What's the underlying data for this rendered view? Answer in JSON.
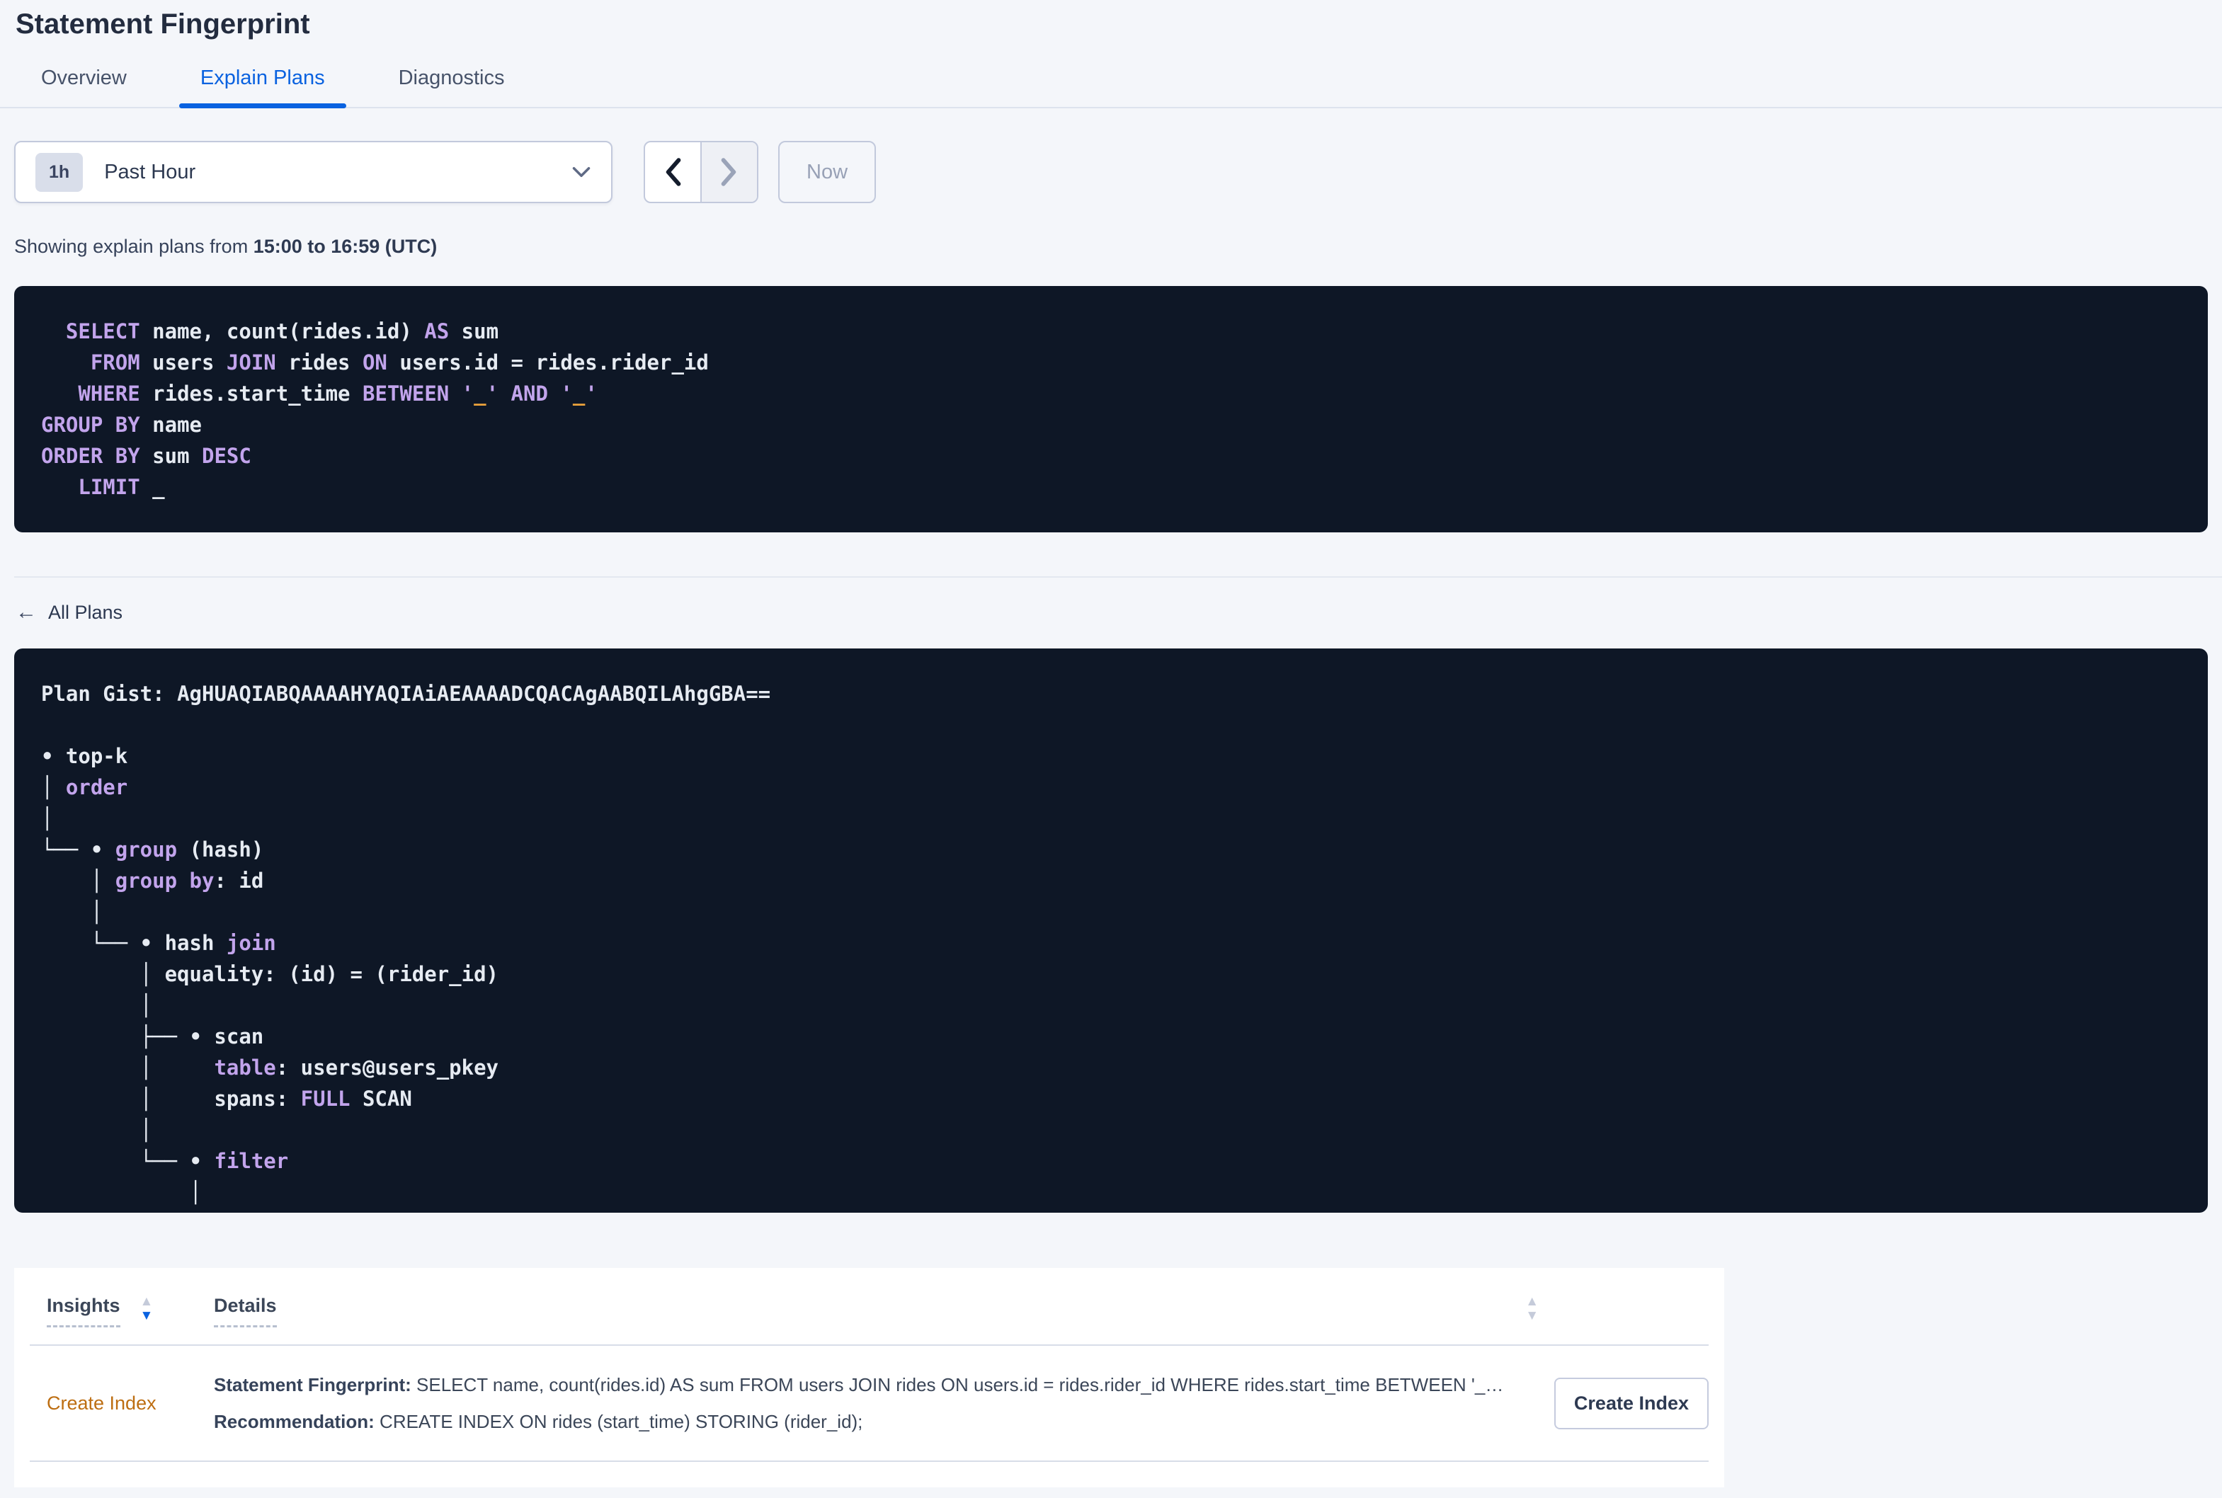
{
  "page_title": "Statement Fingerprint",
  "tabs": [
    {
      "label": "Overview",
      "active": false
    },
    {
      "label": "Explain Plans",
      "active": true
    },
    {
      "label": "Diagnostics",
      "active": false
    }
  ],
  "time_selector": {
    "duration_badge": "1h",
    "selected_label": "Past Hour",
    "now_label": "Now"
  },
  "showing_plans": {
    "prefix": "Showing explain plans from ",
    "range": "15:00 to 16:59 (UTC)"
  },
  "colors": {
    "accent_blue": "#0a62e0",
    "code_background": "#0e1726",
    "code_keyword_purple": "#c2a4ec",
    "code_literal_orange": "#eda43c",
    "insight_link_orange": "#bd6e12"
  },
  "sql_preview": {
    "lines": [
      [
        {
          "t": "  ",
          "c": "pl"
        },
        {
          "t": "SELECT",
          "c": "kw"
        },
        {
          "t": " name, count(rides.id) ",
          "c": "pl"
        },
        {
          "t": "AS",
          "c": "kw"
        },
        {
          "t": " sum",
          "c": "pl"
        }
      ],
      [
        {
          "t": "    ",
          "c": "pl"
        },
        {
          "t": "FROM",
          "c": "kw"
        },
        {
          "t": " users ",
          "c": "pl"
        },
        {
          "t": "JOIN",
          "c": "kw"
        },
        {
          "t": " rides ",
          "c": "pl"
        },
        {
          "t": "ON",
          "c": "kw"
        },
        {
          "t": " users.id = rides.rider_id",
          "c": "pl"
        }
      ],
      [
        {
          "t": "   ",
          "c": "pl"
        },
        {
          "t": "WHERE",
          "c": "kw"
        },
        {
          "t": " rides.start_time ",
          "c": "pl"
        },
        {
          "t": "BETWEEN",
          "c": "kw"
        },
        {
          "t": " ",
          "c": "pl"
        },
        {
          "t": "'",
          "c": "kw"
        },
        {
          "t": "_",
          "c": "num"
        },
        {
          "t": "'",
          "c": "kw"
        },
        {
          "t": " ",
          "c": "pl"
        },
        {
          "t": "AND",
          "c": "kw"
        },
        {
          "t": " ",
          "c": "pl"
        },
        {
          "t": "'",
          "c": "kw"
        },
        {
          "t": "_",
          "c": "num"
        },
        {
          "t": "'",
          "c": "kw"
        }
      ],
      [
        {
          "t": "GROUP BY",
          "c": "kw"
        },
        {
          "t": " name",
          "c": "pl"
        }
      ],
      [
        {
          "t": "ORDER BY",
          "c": "kw"
        },
        {
          "t": " sum ",
          "c": "pl"
        },
        {
          "t": "DESC",
          "c": "kw"
        }
      ],
      [
        {
          "t": "   ",
          "c": "pl"
        },
        {
          "t": "LIMIT",
          "c": "kw"
        },
        {
          "t": " _",
          "c": "pl"
        }
      ]
    ]
  },
  "all_plans_link": "All Plans",
  "plan_details": {
    "gist_label": "Plan Gist:",
    "gist_value": "AgHUAQIABQAAAAHYAQIAiAEAAAADCQACAgAABQILAhgGBA==",
    "tree_lines": [
      [
        {
          "t": "",
          "c": "pl"
        }
      ],
      [
        {
          "t": "• top-k",
          "c": "pl"
        }
      ],
      [
        {
          "t": "│ ",
          "c": "pl"
        },
        {
          "t": "order",
          "c": "kw"
        }
      ],
      [
        {
          "t": "│",
          "c": "pl"
        }
      ],
      [
        {
          "t": "└── • ",
          "c": "pl"
        },
        {
          "t": "group",
          "c": "kw"
        },
        {
          "t": " (hash)",
          "c": "pl"
        }
      ],
      [
        {
          "t": "    │ ",
          "c": "pl"
        },
        {
          "t": "group by",
          "c": "kw"
        },
        {
          "t": ": id",
          "c": "pl"
        }
      ],
      [
        {
          "t": "    │",
          "c": "pl"
        }
      ],
      [
        {
          "t": "    └── • hash ",
          "c": "pl"
        },
        {
          "t": "join",
          "c": "kw"
        }
      ],
      [
        {
          "t": "        │ equality: (id) = (rider_id)",
          "c": "pl"
        }
      ],
      [
        {
          "t": "        │",
          "c": "pl"
        }
      ],
      [
        {
          "t": "        ├── • scan",
          "c": "pl"
        }
      ],
      [
        {
          "t": "        │     ",
          "c": "pl"
        },
        {
          "t": "table",
          "c": "kw"
        },
        {
          "t": ": users@users_pkey",
          "c": "pl"
        }
      ],
      [
        {
          "t": "        │     spans: ",
          "c": "pl"
        },
        {
          "t": "FULL",
          "c": "kw"
        },
        {
          "t": " SCAN",
          "c": "pl"
        }
      ],
      [
        {
          "t": "        │",
          "c": "pl"
        }
      ],
      [
        {
          "t": "        └── • ",
          "c": "pl"
        },
        {
          "t": "filter",
          "c": "kw"
        }
      ],
      [
        {
          "t": "            │",
          "c": "pl"
        }
      ]
    ]
  },
  "insights_table": {
    "headers": [
      {
        "label": "Insights",
        "sort": "desc"
      },
      {
        "label": "Details",
        "sort": "none"
      }
    ],
    "rows": [
      {
        "insight_type": "Create Index",
        "details": [
          {
            "label": "Statement Fingerprint:",
            "text": " SELECT name, count(rides.id) AS sum FROM users JOIN rides ON users.id = rides.rider_id WHERE rides.start_time BETWEEN '_…"
          },
          {
            "label": "Recommendation:",
            "text": " CREATE INDEX ON rides (start_time) STORING (rider_id);"
          }
        ],
        "action_label": "Create Index"
      }
    ]
  }
}
